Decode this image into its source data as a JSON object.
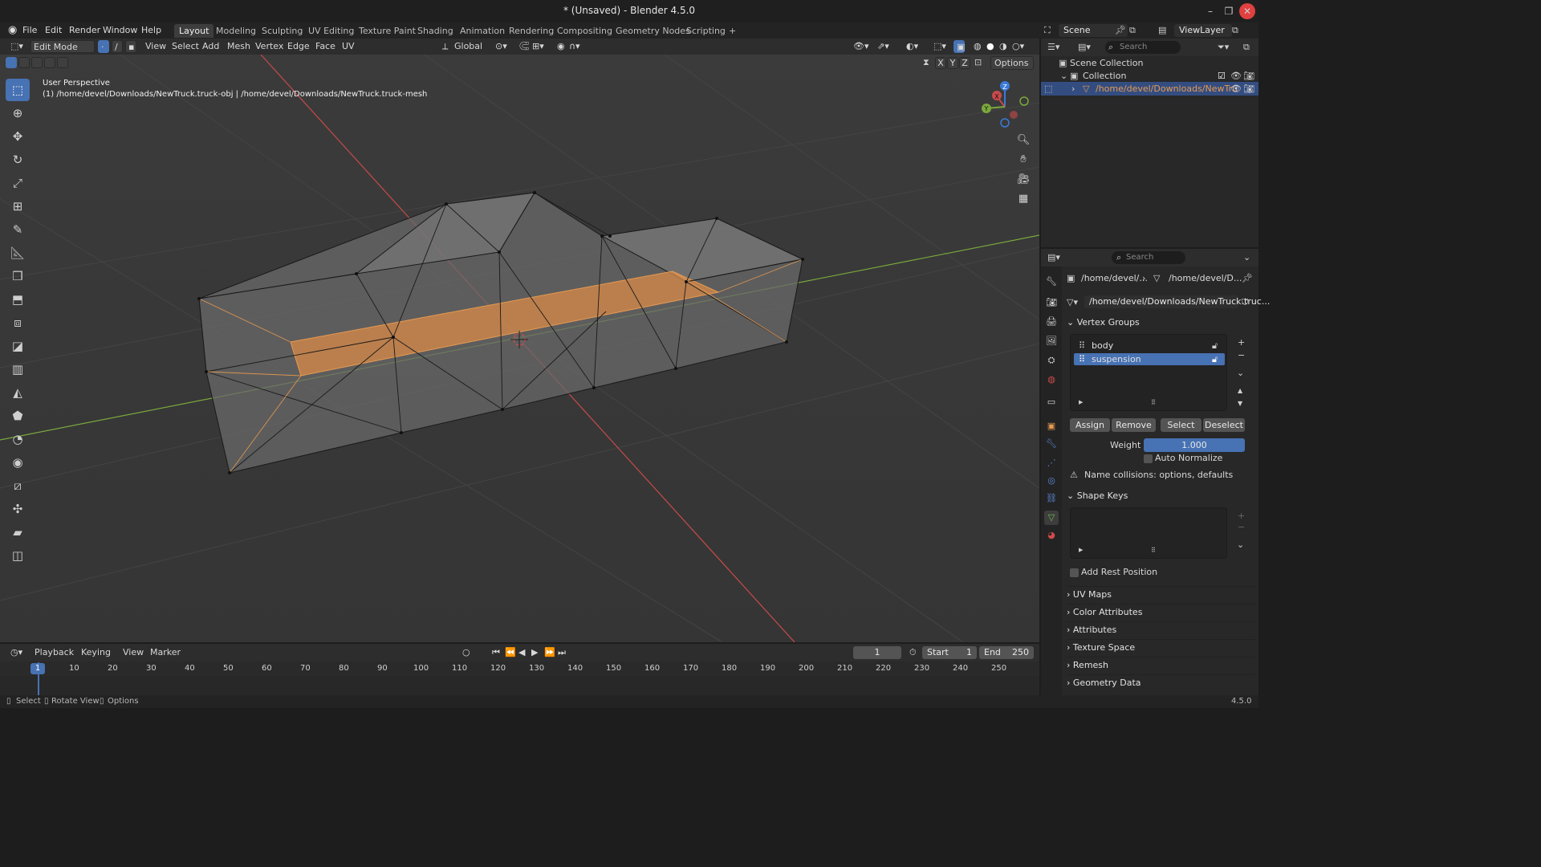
{
  "window": {
    "title": "* (Unsaved) - Blender 4.5.0",
    "minimize": "–",
    "maximize": "❐",
    "close": "✕"
  },
  "menu": {
    "items": [
      "File",
      "Edit",
      "Render",
      "Window",
      "Help"
    ],
    "workspaces": [
      "Layout",
      "Modeling",
      "Sculpting",
      "UV Editing",
      "Texture Paint",
      "Shading",
      "Animation",
      "Rendering",
      "Compositing",
      "Geometry Nodes",
      "Scripting"
    ],
    "add_workspace": "+"
  },
  "topright": {
    "scene": "Scene",
    "viewlayer": "ViewLayer"
  },
  "viewport": {
    "mode": "Edit Mode",
    "menus": [
      "View",
      "Select",
      "Add",
      "Mesh",
      "Vertex",
      "Edge",
      "Face",
      "UV"
    ],
    "transform_orientation": "Global",
    "options": "Options",
    "axes": [
      "X",
      "Y",
      "Z"
    ],
    "info_line1": "User Perspective",
    "info_line2": "(1) /home/devel/Downloads/NewTruck.truck-obj | /home/devel/Downloads/NewTruck.truck-mesh",
    "gizmo": {
      "z": "Z",
      "x": "X",
      "y": "Y"
    }
  },
  "timeline": {
    "menus": [
      "Playback",
      "Keying",
      "View",
      "Marker"
    ],
    "current_frame": "1",
    "start_label": "Start",
    "start": "1",
    "end_label": "End",
    "end": "250",
    "ticks": [
      "10",
      "20",
      "30",
      "40",
      "50",
      "60",
      "70",
      "80",
      "90",
      "100",
      "110",
      "120",
      "130",
      "140",
      "150",
      "160",
      "170",
      "180",
      "190",
      "200",
      "210",
      "220",
      "230",
      "240",
      "250"
    ],
    "playhead_frame": "1"
  },
  "statusbar": {
    "select": "Select",
    "rotate": "Rotate View",
    "options": "Options",
    "version": "4.5.0"
  },
  "outliner": {
    "search_placeholder": "Search",
    "scene_collection": "Scene Collection",
    "collection": "Collection",
    "object": "/home/devel/Downloads/NewTru"
  },
  "properties": {
    "search_placeholder": "Search",
    "breadcrumb_obj": "/home/devel/...",
    "breadcrumb_mesh": "/home/devel/D...",
    "mesh_name": "/home/devel/Downloads/NewTruck.truc...",
    "vertex_groups": {
      "title": "Vertex Groups",
      "items": [
        "body",
        "suspension"
      ],
      "selected_index": 1,
      "assign": "Assign",
      "remove": "Remove",
      "select": "Select",
      "deselect": "Deselect",
      "weight_label": "Weight",
      "weight": "1.000",
      "auto_normalize": "Auto Normalize",
      "warning": "Name collisions: options, defaults"
    },
    "shape_keys": {
      "title": "Shape Keys",
      "add_rest_position": "Add Rest Position"
    },
    "collapsed_panels": [
      "UV Maps",
      "Color Attributes",
      "Attributes",
      "Texture Space",
      "Remesh",
      "Geometry Data"
    ]
  },
  "colors": {
    "accent": "#4772b3",
    "selection_orange": "#e89a50",
    "x_axis": "#c84a4a",
    "y_axis": "#7aa83c",
    "z_axis": "#3b7ad9"
  }
}
